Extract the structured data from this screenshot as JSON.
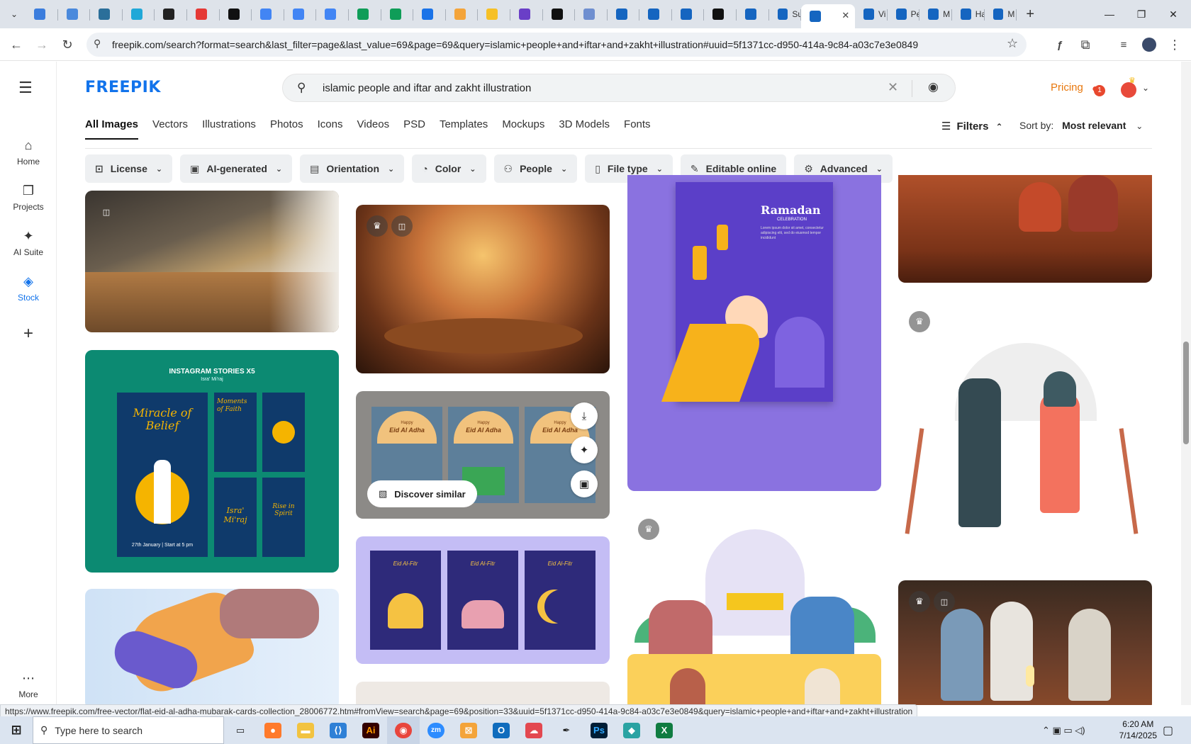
{
  "browser": {
    "active_tab_close": "✕",
    "new_tab": "+",
    "tabs": [
      {
        "color": "#3b7ddd",
        "title": ""
      },
      {
        "color": "#4a89dc",
        "title": ""
      },
      {
        "color": "#2b6f9a",
        "title": ""
      },
      {
        "color": "#20a8d8",
        "title": ""
      },
      {
        "color": "#222222",
        "title": ""
      },
      {
        "color": "#e53935",
        "title": ""
      },
      {
        "color": "#111111",
        "title": ""
      },
      {
        "color": "#4285f4",
        "title": ""
      },
      {
        "color": "#4285f4",
        "title": ""
      },
      {
        "color": "#4285f4",
        "title": ""
      },
      {
        "color": "#0f9d58",
        "title": ""
      },
      {
        "color": "#0f9d58",
        "title": ""
      },
      {
        "color": "#1a73e8",
        "title": ""
      },
      {
        "color": "#f4a43a",
        "title": ""
      },
      {
        "color": "#f6c026",
        "title": ""
      },
      {
        "color": "#6a3fc7",
        "title": ""
      },
      {
        "color": "#111111",
        "title": ""
      },
      {
        "color": "#6f8fd0",
        "title": ""
      },
      {
        "color": "#1565c0",
        "title": ""
      },
      {
        "color": "#1565c0",
        "title": ""
      },
      {
        "color": "#1565c0",
        "title": ""
      },
      {
        "color": "#111111",
        "title": ""
      },
      {
        "color": "#1565c0",
        "title": ""
      },
      {
        "color": "#1565c0",
        "title": "Su"
      },
      {
        "color": "#1565c0",
        "title": "",
        "active": true
      },
      {
        "color": "#1565c0",
        "title": "Vi"
      },
      {
        "color": "#1565c0",
        "title": "Pe"
      },
      {
        "color": "#1565c0",
        "title": "M"
      },
      {
        "color": "#1565c0",
        "title": "Ha"
      },
      {
        "color": "#1565c0",
        "title": "M"
      }
    ],
    "url": "freepik.com/search?format=search&last_filter=page&last_value=69&page=69&query=islamic+people+and+iftar+and+zakht+illustration#uuid=5f1371cc-d950-414a-9c84-a03c7e3e0849",
    "status_link": "https://www.freepik.com/free-vector/flat-eid-al-adha-mubarak-cards-collection_28006772.htm#fromView=search&page=69&position=33&uuid=5f1371cc-d950-414a-9c84-a03c7e3e0849&query=islamic+people+and+iftar+and+zakht+illustration"
  },
  "site": {
    "logo": "FREEPIK",
    "search_query": "islamic people and iftar and zakht illustration",
    "pricing": "Pricing",
    "notif_count": "1",
    "sidebar": [
      {
        "label": "Home",
        "icon": "⌂"
      },
      {
        "label": "Projects",
        "icon": "❐"
      },
      {
        "label": "AI Suite",
        "icon": "✦"
      },
      {
        "label": "Stock",
        "icon": "◈"
      }
    ],
    "more_label": "More",
    "categories": [
      "All Images",
      "Vectors",
      "Illustrations",
      "Photos",
      "Icons",
      "Videos",
      "PSD",
      "Templates",
      "Mockups",
      "3D Models",
      "Fonts"
    ],
    "filters_label": "Filters",
    "sort_label": "Sort by:",
    "sort_value": "Most relevant",
    "filter_chips": [
      {
        "label": "License",
        "icon": "⊡"
      },
      {
        "label": "AI-generated",
        "icon": "▣"
      },
      {
        "label": "Orientation",
        "icon": "▤"
      },
      {
        "label": "Color",
        "icon": "◔"
      },
      {
        "label": "People",
        "icon": "⚇"
      },
      {
        "label": "File type",
        "icon": "▯"
      },
      {
        "label": "Editable online",
        "icon": "✎"
      },
      {
        "label": "Advanced",
        "icon": "⚙"
      }
    ],
    "discover_similar": "Discover similar"
  },
  "cards": {
    "c4": {
      "title": "INSTAGRAM STORIES X5",
      "subtitle": "Isra' Mi'raj",
      "headline": "Miracle of Belief",
      "side1": "Moments of Faith",
      "side2": "Isra' Mi'raj",
      "side3": "Rise in Spirit",
      "footer": "27th January  |  Start at 5 pm",
      "colors": {
        "bg": "#0c8a72",
        "panel": "#0f3a6b",
        "accent": "#f5b400"
      }
    },
    "c6": {
      "card_label": "Eid Al Adha",
      "kicker": "Happy",
      "colors": {
        "bg": "#8c8a87",
        "card": "#5d7f9a",
        "arch": "#f1c27d"
      }
    },
    "c7": {
      "card_label": "Eid Al-Fitr",
      "colors": {
        "bg": "#c4bdf5",
        "card": "#2e2a7a",
        "accent": "#f5c242"
      }
    },
    "c9": {
      "title": "Ramadan",
      "subtitle": "CELEBRATION",
      "body": "Lorem ipsum dolor sit amet, consectetur adipiscing elit, sed do eiusmod tempor incididunt",
      "colors": {
        "bg": "#8a72e0",
        "poster": "#5b3fc8",
        "sleeve": "#f7b21b",
        "hand": "#ffd8b8"
      }
    }
  },
  "taskbar": {
    "search_placeholder": "Type here to search",
    "time": "6:20 AM",
    "date": "7/14/2025"
  }
}
